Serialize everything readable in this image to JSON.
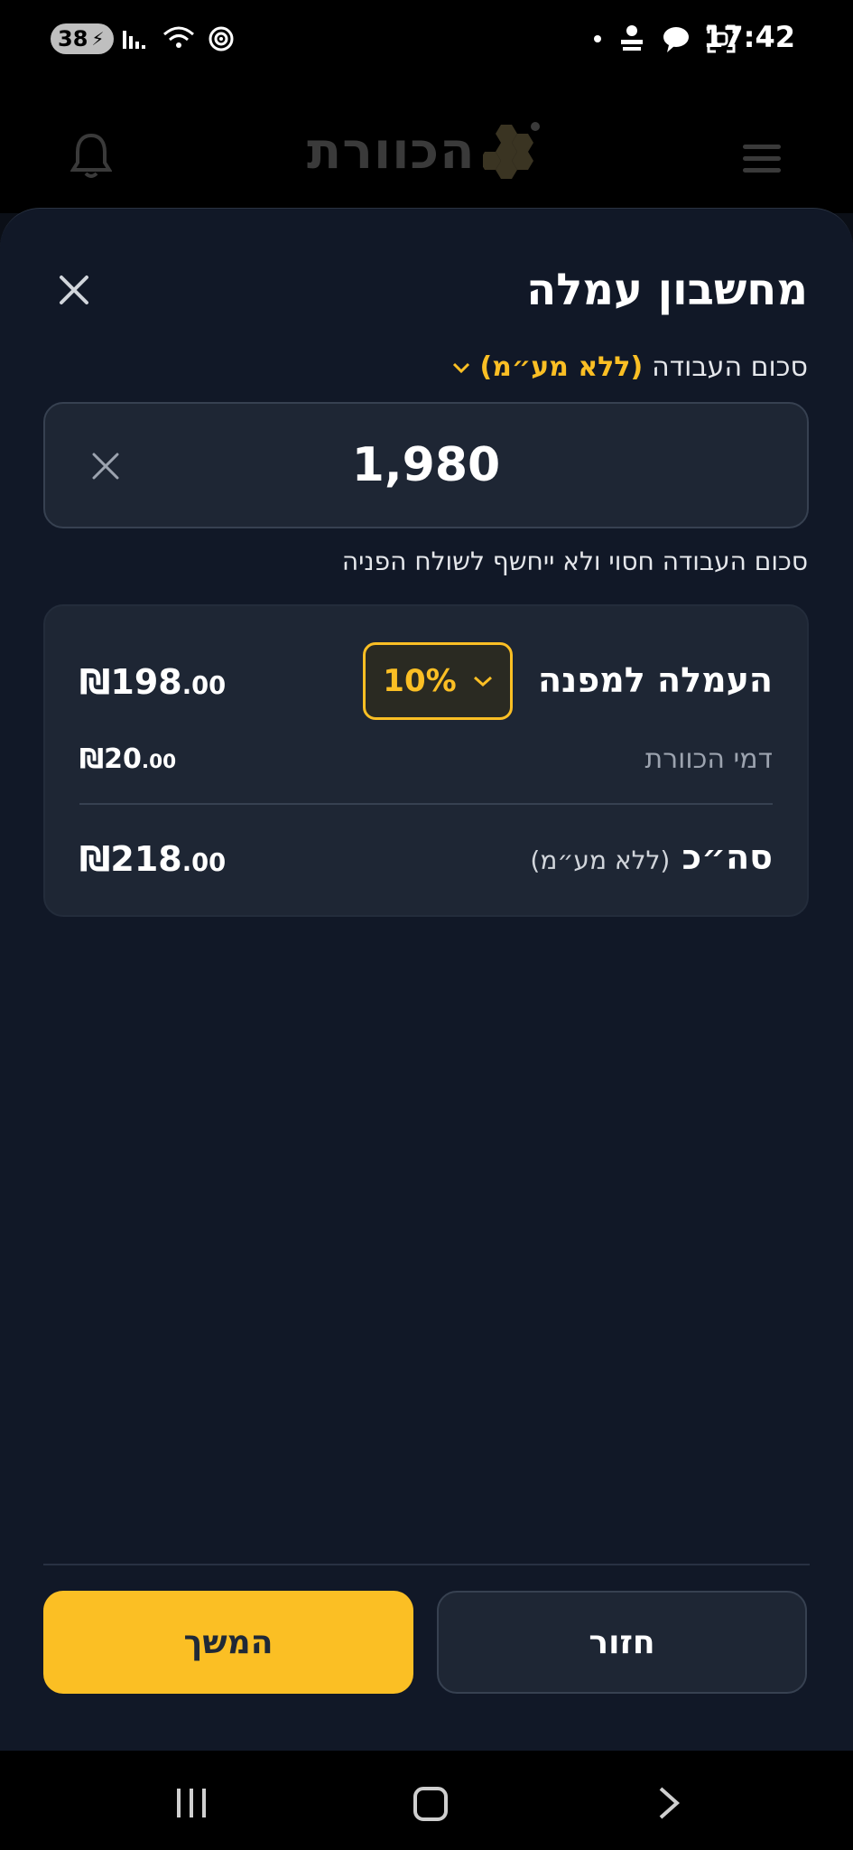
{
  "status_bar": {
    "battery": "38",
    "time": "17:42",
    "icons_left": [
      "signal-icon",
      "wifi-icon",
      "hotspot-icon"
    ],
    "icons_right": [
      "dot-icon",
      "burger-saloon-icon",
      "chat-icon",
      "screenshot-icon"
    ]
  },
  "header": {
    "logo_text": "הכוורת",
    "icons": [
      "bell-icon",
      "menu-icon",
      "honeycomb-logo-icon"
    ]
  },
  "sheet": {
    "title": "מחשבון עמלה",
    "amount_label": "סכום העבודה",
    "amount_label_highlight": "(ללא מע״מ)",
    "amount_value": "1,980",
    "hint": "סכום העבודה חסוי ולא ייחשף לשולח הפניה",
    "commission": {
      "label": "העמלה למפנה",
      "percent": "10%",
      "amount_int": "198",
      "amount_dec": ".00",
      "currency": "₪"
    },
    "fee": {
      "label": "דמי הכוורת",
      "amount_int": "20",
      "amount_dec": ".00",
      "currency": "₪"
    },
    "total": {
      "label": "סה״כ",
      "sub": "(ללא מע״מ)",
      "amount_int": "218",
      "amount_dec": ".00",
      "currency": "₪"
    },
    "buttons": {
      "continue": "המשך",
      "back": "חזור"
    }
  },
  "colors": {
    "accent": "#fbbf24",
    "sheet_bg": "#111827",
    "card_bg": "#1e2634"
  }
}
